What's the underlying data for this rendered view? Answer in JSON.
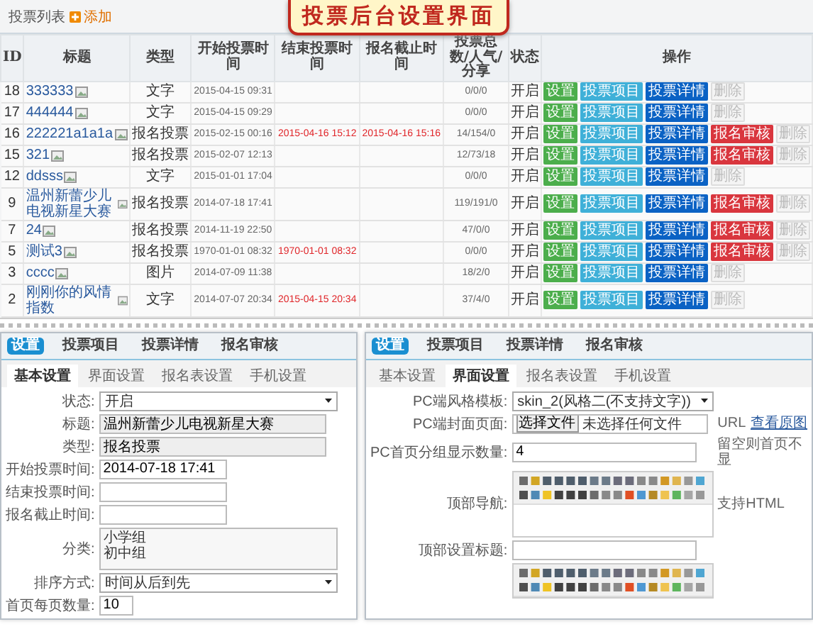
{
  "banner": {
    "title": "投票后台设置界面"
  },
  "list_header": {
    "title": "投票列表",
    "add_label": "添加"
  },
  "table": {
    "columns": [
      "ID",
      "标题",
      "类型",
      "开始投票时间",
      "结束投票时间",
      "报名截止时间",
      "投票总数/人气/分享",
      "状态",
      "操作"
    ],
    "rows": [
      {
        "id": "18",
        "title": "333333",
        "type": "文字",
        "start_time": "2015-04-15 09:31",
        "stats": "0/0/0",
        "status": "开启",
        "actions": [
          {
            "kind": "settings",
            "label": "设置"
          },
          {
            "kind": "items",
            "label": "投票项目"
          },
          {
            "kind": "details",
            "label": "投票详情"
          },
          {
            "kind": "delete",
            "label": "删除"
          }
        ]
      },
      {
        "id": "17",
        "title": "444444",
        "type": "文字",
        "start_time": "2015-04-15 09:29",
        "stats": "0/0/0",
        "status": "开启",
        "actions": [
          {
            "kind": "settings",
            "label": "设置"
          },
          {
            "kind": "items",
            "label": "投票项目"
          },
          {
            "kind": "details",
            "label": "投票详情"
          },
          {
            "kind": "delete",
            "label": "删除"
          }
        ]
      },
      {
        "id": "16",
        "title": "222221a1a1a",
        "type": "报名投票",
        "start_time": "2015-02-15 00:16",
        "end_time": "2015-04-16 15:12",
        "deadline": "2015-04-16 15:16",
        "stats": "14/154/0",
        "status": "开启",
        "actions": [
          {
            "kind": "settings",
            "label": "设置"
          },
          {
            "kind": "items",
            "label": "投票项目"
          },
          {
            "kind": "details",
            "label": "投票详情"
          },
          {
            "kind": "review",
            "label": "报名审核"
          },
          {
            "kind": "delete",
            "label": "删除"
          }
        ]
      },
      {
        "id": "15",
        "title": "321",
        "type": "报名投票",
        "start_time": "2015-02-07 12:13",
        "stats": "12/73/18",
        "status": "开启",
        "actions": [
          {
            "kind": "settings",
            "label": "设置"
          },
          {
            "kind": "items",
            "label": "投票项目"
          },
          {
            "kind": "details",
            "label": "投票详情"
          },
          {
            "kind": "review",
            "label": "报名审核"
          },
          {
            "kind": "delete",
            "label": "删除"
          }
        ]
      },
      {
        "id": "12",
        "title": "ddsss",
        "type": "文字",
        "start_time": "2015-01-01 17:04",
        "stats": "0/0/0",
        "status": "开启",
        "actions": [
          {
            "kind": "settings",
            "label": "设置"
          },
          {
            "kind": "items",
            "label": "投票项目"
          },
          {
            "kind": "details",
            "label": "投票详情"
          },
          {
            "kind": "delete",
            "label": "删除"
          }
        ]
      },
      {
        "id": "9",
        "title": "温州新蕾少儿电视新星大赛",
        "type": "报名投票",
        "start_time": "2014-07-18 17:41",
        "stats": "119/191/0",
        "status": "开启",
        "actions": [
          {
            "kind": "settings",
            "label": "设置"
          },
          {
            "kind": "items",
            "label": "投票项目"
          },
          {
            "kind": "details",
            "label": "投票详情"
          },
          {
            "kind": "review",
            "label": "报名审核"
          },
          {
            "kind": "delete",
            "label": "删除"
          }
        ]
      },
      {
        "id": "7",
        "title": "24",
        "type": "报名投票",
        "start_time": "2014-11-19 22:50",
        "stats": "47/0/0",
        "status": "开启",
        "actions": [
          {
            "kind": "settings",
            "label": "设置"
          },
          {
            "kind": "items",
            "label": "投票项目"
          },
          {
            "kind": "details",
            "label": "投票详情"
          },
          {
            "kind": "review",
            "label": "报名审核"
          },
          {
            "kind": "delete",
            "label": "删除"
          }
        ]
      },
      {
        "id": "5",
        "title": "测试3",
        "type": "报名投票",
        "start_time": "1970-01-01 08:32",
        "end_time": "1970-01-01 08:32",
        "stats": "0/0/0",
        "status": "开启",
        "actions": [
          {
            "kind": "settings",
            "label": "设置"
          },
          {
            "kind": "items",
            "label": "投票项目"
          },
          {
            "kind": "details",
            "label": "投票详情"
          },
          {
            "kind": "review",
            "label": "报名审核"
          },
          {
            "kind": "delete",
            "label": "删除"
          }
        ]
      },
      {
        "id": "3",
        "title": "cccc",
        "type": "图片",
        "start_time": "2014-07-09 11:38",
        "stats": "18/2/0",
        "status": "开启",
        "actions": [
          {
            "kind": "settings",
            "label": "设置"
          },
          {
            "kind": "items",
            "label": "投票项目"
          },
          {
            "kind": "details",
            "label": "投票详情"
          },
          {
            "kind": "delete",
            "label": "删除"
          }
        ]
      },
      {
        "id": "2",
        "title": "刚刚你的风情指数",
        "type": "文字",
        "start_time": "2014-07-07 20:34",
        "end_time": "2015-04-15 20:34",
        "stats": "37/4/0",
        "status": "开启",
        "actions": [
          {
            "kind": "settings",
            "label": "设置"
          },
          {
            "kind": "items",
            "label": "投票项目"
          },
          {
            "kind": "details",
            "label": "投票详情"
          },
          {
            "kind": "delete",
            "label": "删除"
          }
        ]
      }
    ]
  },
  "settings_panels": [
    {
      "tabs": [
        {
          "label": "设置",
          "selected": true
        },
        {
          "label": "投票项目",
          "selected": false
        },
        {
          "label": "投票详情",
          "selected": false
        },
        {
          "label": "报名审核",
          "selected": false
        }
      ],
      "subtabs": [
        {
          "label": "基本设置",
          "selected": true
        },
        {
          "label": "界面设置",
          "selected": false
        },
        {
          "label": "报名表设置",
          "selected": false
        },
        {
          "label": "手机设置",
          "selected": false
        }
      ],
      "fields": [
        {
          "kind": "select",
          "label": "状态:",
          "value": "开启"
        },
        {
          "kind": "text",
          "label": "标题:",
          "value": "温州新蕾少儿电视新星大赛",
          "readonly": true
        },
        {
          "kind": "text",
          "label": "类型:",
          "value": "报名投票",
          "readonly": true
        },
        {
          "kind": "date",
          "label": "开始投票时间:",
          "value": "2014-07-18 17:41"
        },
        {
          "kind": "date",
          "label": "结束投票时间:"
        },
        {
          "kind": "date",
          "label": "报名截止时间:"
        },
        {
          "kind": "textarea",
          "label": "分类:",
          "lines": [
            "小学组",
            "初中组"
          ]
        },
        {
          "kind": "select",
          "label": "排序方式:",
          "value": "时间从后到先"
        },
        {
          "kind": "short",
          "label": "首页每页数量:",
          "value": "10"
        }
      ]
    },
    {
      "tabs": [
        {
          "label": "设置",
          "selected": true
        },
        {
          "label": "投票项目",
          "selected": false
        },
        {
          "label": "投票详情",
          "selected": false
        },
        {
          "label": "报名审核",
          "selected": false
        }
      ],
      "subtabs": [
        {
          "label": "基本设置",
          "selected": false
        },
        {
          "label": "界面设置",
          "selected": true
        },
        {
          "label": "报名表设置",
          "selected": false
        },
        {
          "label": "手机设置",
          "selected": false
        }
      ],
      "fields": [
        {
          "kind": "select",
          "label": "PC端风格模板:",
          "value": "skin_2(风格二(不支持文字))"
        },
        {
          "kind": "file",
          "label": "PC端封面页面:",
          "button_label": "选择文件",
          "value": "未选择任何文件",
          "note": "URL",
          "link": "查看原图"
        },
        {
          "kind": "text",
          "label": "PC首页分组显示数量:",
          "value": "4",
          "note": "留空则首页不显"
        },
        {
          "kind": "editor",
          "label": "顶部导航:",
          "note": "支持HTML"
        },
        {
          "kind": "text",
          "label": "顶部设置标题:"
        },
        {
          "kind": "editor_toolbar"
        }
      ]
    }
  ]
}
